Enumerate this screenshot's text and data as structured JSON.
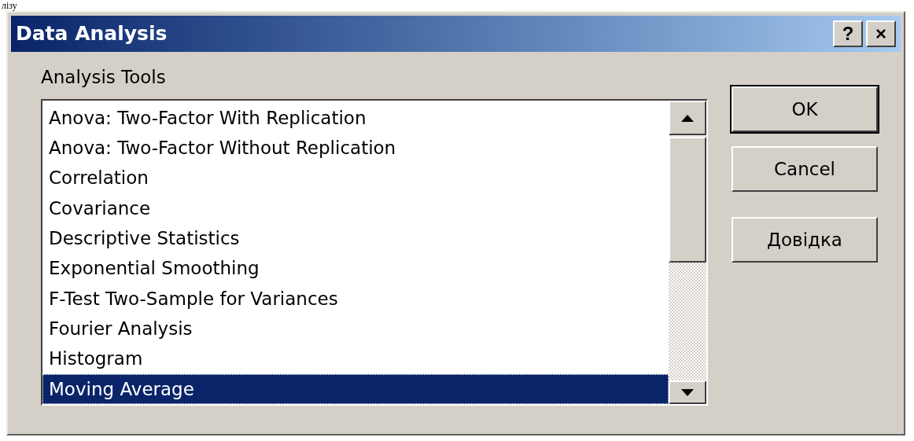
{
  "page_text": "лізу",
  "window": {
    "title": "Data Analysis",
    "title_buttons": [
      "?",
      "×"
    ]
  },
  "label": "Analysis Tools",
  "list": {
    "items": [
      {
        "label": "Anova: Two-Factor With Replication",
        "selected": false
      },
      {
        "label": "Anova: Two-Factor Without Replication",
        "selected": false
      },
      {
        "label": "Correlation",
        "selected": false
      },
      {
        "label": "Covariance",
        "selected": false
      },
      {
        "label": "Descriptive Statistics",
        "selected": false
      },
      {
        "label": "Exponential Smoothing",
        "selected": false
      },
      {
        "label": "F-Test Two-Sample for Variances",
        "selected": false
      },
      {
        "label": "Fourier Analysis",
        "selected": false
      },
      {
        "label": "Histogram",
        "selected": false
      },
      {
        "label": "Moving Average",
        "selected": true
      }
    ]
  },
  "buttons": [
    {
      "label": "OK",
      "default": true
    },
    {
      "label": "Cancel",
      "default": false
    },
    {
      "label": "Довідка",
      "default": false
    }
  ]
}
